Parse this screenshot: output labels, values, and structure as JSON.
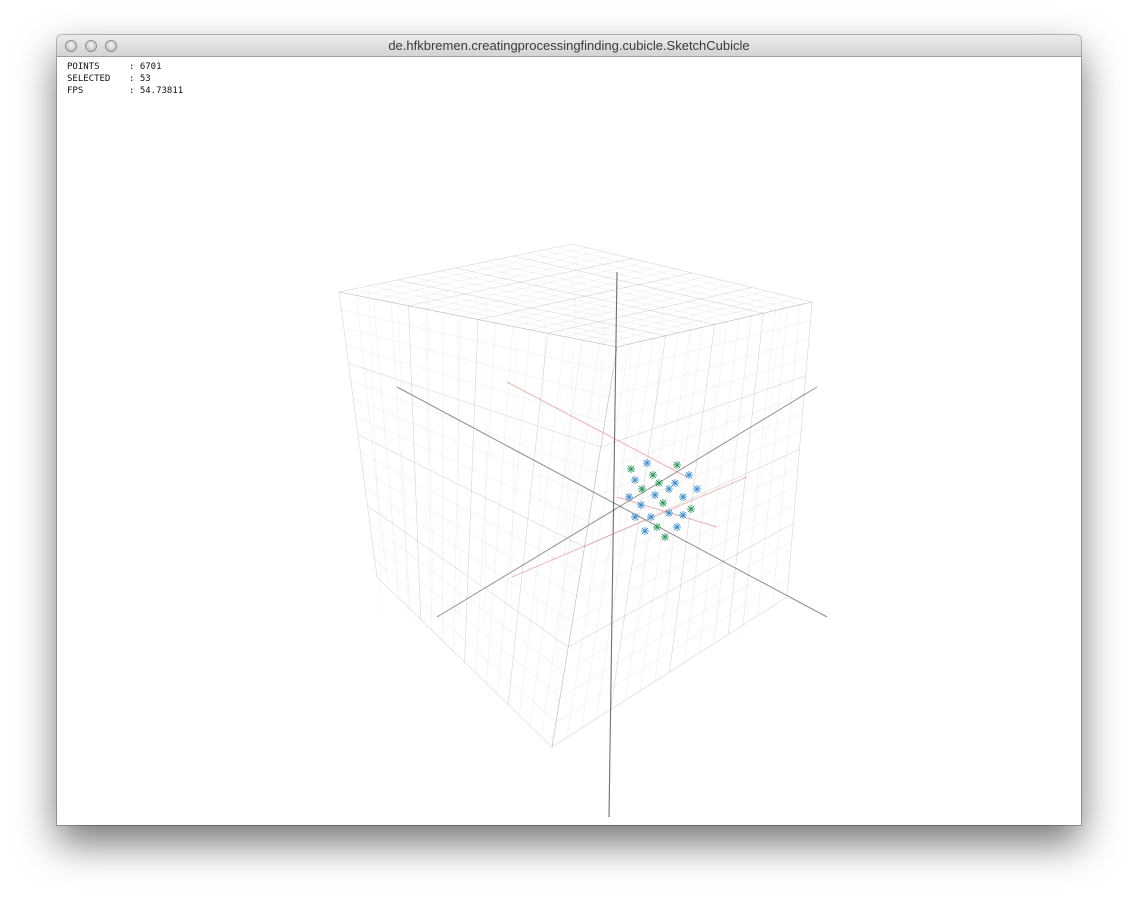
{
  "window": {
    "title": "de.hfkbremen.creatingprocessingfinding.cubicle.SketchCubicle"
  },
  "stats": {
    "points_label": "POINTS",
    "points_value": "6701",
    "selected_label": "SELECTED",
    "selected_value": "53",
    "fps_label": "FPS",
    "fps_value": "54.73811"
  },
  "colors": {
    "grid": "#8a8a8a",
    "axis_red": "#e05a50",
    "point_blue": "#3a8fd0",
    "point_green": "#2e9a5a",
    "titlebar_text": "#3a3a3a"
  }
}
